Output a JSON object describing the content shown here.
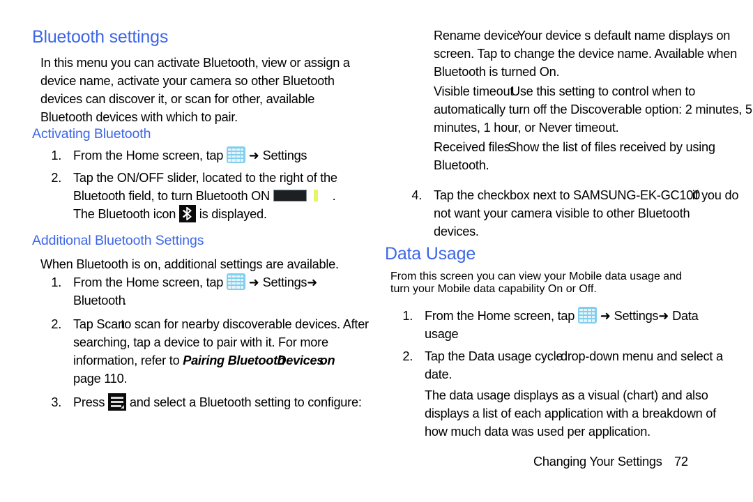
{
  "document": {
    "footer": {
      "chapter_label": "Changing Your Settings",
      "page_number": "72"
    }
  },
  "left_column": {
    "section_title": "Bluetooth settings",
    "intro": "In this menu you can activate Bluetooth, view or assign a device name, activate your camera so other Bluetooth devices can discover it, or scan for other, available Bluetooth devices with which to pair.",
    "activating": {
      "heading": "Activating Bluetooth",
      "step1": {
        "number": "1.",
        "text_before_icon": "From the Home screen, tap",
        "arrow": "➜",
        "text_after_icon": "Settings",
        "icon": "apps-grid-icon"
      },
      "step2": {
        "number": "2.",
        "line1": "Tap the ON/OFF slider, located to the right of the",
        "line2_before": "Bluetooth field, to turn Bluetooth ON",
        "line2_after": ".",
        "line3_before": "The Bluetooth icon",
        "line3_after": "is displayed.",
        "slider_icon": "onoff-slider-icon",
        "bluetooth_icon": "bluetooth-icon"
      }
    },
    "additional": {
      "heading": "Additional Bluetooth Settings",
      "intro": "When Bluetooth is on, additional settings are available.",
      "step1": {
        "number": "1.",
        "text_before_icon": "From the Home screen, tap",
        "arrow1": "➜",
        "text_after_icon": "Settings",
        "arrow2": "➜",
        "line2": "Bluetooth",
        "line2_trail": ".",
        "icon": "apps-grid-icon"
      },
      "step2": {
        "number": "2.",
        "seg_a": "Tap Scan",
        "seg_b": "to scan for nearby discoverable devices. After",
        "line2": "searching, tap a device to pair with it. For more",
        "line3_lead": "information, refer to",
        "bold_a": "Pairing Bluetooth",
        "bold_b": "Devices",
        "bold_c": "on",
        "line4": "page 110."
      },
      "step3": {
        "number": "3.",
        "text_before_icon": "Press",
        "text_after_icon": "and select a Bluetooth setting to configure:",
        "icon": "menu-icon"
      }
    }
  },
  "right_column": {
    "settings_list": [
      {
        "term": "Rename device",
        "description_line1": "Your device s default name displays on",
        "description_line2": "screen. Tap to change the device name. Available when",
        "description_line3": "Bluetooth is turned On."
      },
      {
        "term": "Visible timeout",
        "description_line1": "Use this setting to control when to",
        "description_line2": "automatically turn off the Discoverable option: 2 minutes, 5",
        "description_line3": "minutes, 1 hour, or Never timeout."
      },
      {
        "term": "Received files",
        "description_line1": "Show the list of files received by using",
        "description_line2": "Bluetooth."
      }
    ],
    "step4": {
      "number": "4.",
      "seg_a": "Tap the checkbox next to SAMSUNG-EK-GC100",
      "seg_b": "if you do",
      "line2": "not want your camera visible to other Bluetooth",
      "line3": "devices."
    },
    "data_usage": {
      "section_title": "Data Usage",
      "intro_line1": "From this screen you can view your Mobile data usage and",
      "intro_line2": "turn your Mobile data capability On or Off.",
      "step1": {
        "number": "1.",
        "text_before_icon": "From the Home screen, tap",
        "arrow1": "➜",
        "text_mid": "Settings",
        "arrow2": "➜",
        "text_end": "Data",
        "line2": "usage",
        "icon": "apps-grid-icon"
      },
      "step2": {
        "number": "2.",
        "seg_a": "Tap the Data usage cycle",
        "seg_b": "drop-down menu and select a",
        "line2": "date."
      },
      "note_line1": "The data usage displays as a visual (chart) and also",
      "note_line2": "displays a list of each application with a breakdown of",
      "note_line3": "how much data was used per application."
    }
  },
  "colors": {
    "heading_blue": "#3d66e8",
    "apps_icon_blue": "#7fd0ef",
    "slider_dark": "#1c2023",
    "slider_accent": "#e6f562",
    "icon_black": "#0b0b0b"
  }
}
